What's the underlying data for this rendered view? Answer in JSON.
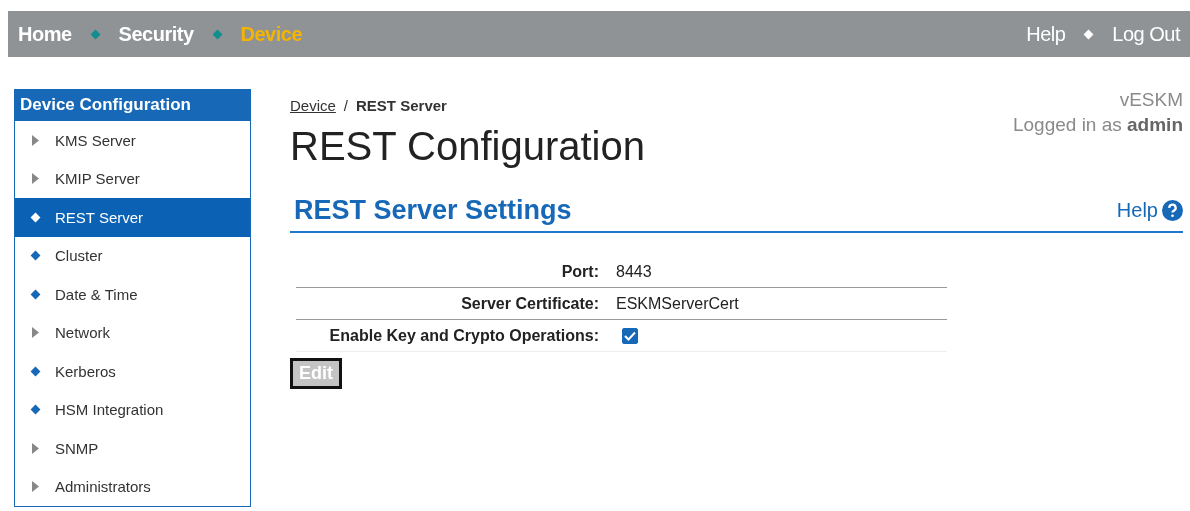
{
  "top_nav": {
    "left": [
      {
        "label": "Home",
        "selected": false
      },
      {
        "label": "Security",
        "selected": false
      },
      {
        "label": "Device",
        "selected": true
      }
    ],
    "right": [
      {
        "label": "Help"
      },
      {
        "label": "Log Out"
      }
    ]
  },
  "sidebar": {
    "title": "Device Configuration",
    "items": [
      {
        "label": "KMS Server",
        "kind": "expandable",
        "selected": false
      },
      {
        "label": "KMIP Server",
        "kind": "expandable",
        "selected": false
      },
      {
        "label": "REST Server",
        "kind": "page",
        "selected": true
      },
      {
        "label": "Cluster",
        "kind": "page",
        "selected": false
      },
      {
        "label": "Date & Time",
        "kind": "page",
        "selected": false
      },
      {
        "label": "Network",
        "kind": "expandable",
        "selected": false
      },
      {
        "label": "Kerberos",
        "kind": "page",
        "selected": false
      },
      {
        "label": "HSM Integration",
        "kind": "page",
        "selected": false
      },
      {
        "label": "SNMP",
        "kind": "expandable",
        "selected": false
      },
      {
        "label": "Administrators",
        "kind": "expandable",
        "selected": false
      }
    ]
  },
  "breadcrumb": [
    {
      "label": "Device",
      "link": true
    },
    {
      "label": "REST Server",
      "link": false
    }
  ],
  "breadcrumb_separator": "/",
  "appliance": "vESKM",
  "login": "Logged in as **admin**",
  "page_title": "REST Configuration",
  "section": {
    "title": "REST Server Settings",
    "help": "Help"
  },
  "settings": [
    {
      "label": "Port:",
      "kind": "text",
      "value": "8443"
    },
    {
      "label": "Server Certificate:",
      "kind": "text",
      "value": "ESKMServerCert"
    },
    {
      "label": "Enable Key and Crypto Operations:",
      "kind": "checkbox",
      "checked": true
    }
  ],
  "edit_button": {
    "label": "Edit",
    "disabled": true
  }
}
